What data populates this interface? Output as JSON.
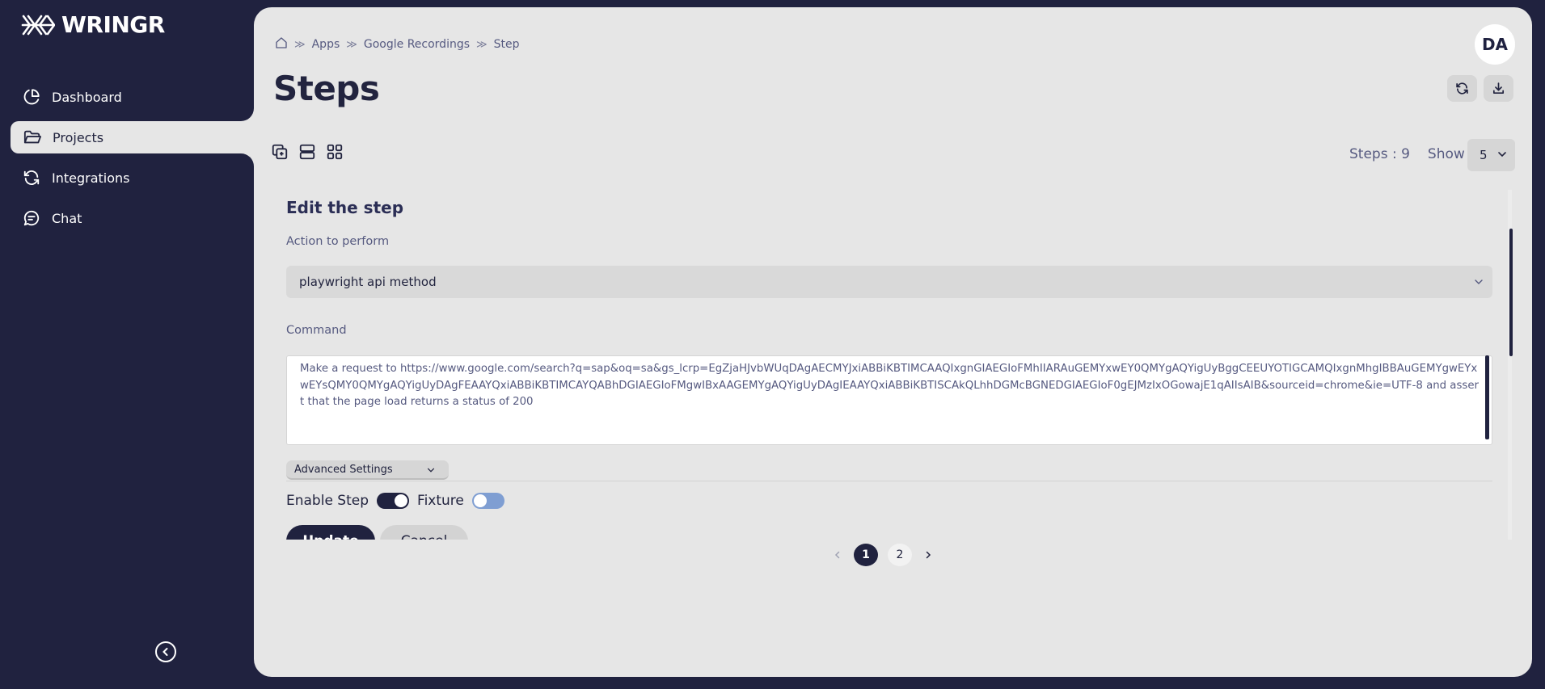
{
  "app": {
    "brand": "WRINGR"
  },
  "sidebar": {
    "items": [
      {
        "label": "Dashboard",
        "icon": "pie-chart-icon"
      },
      {
        "label": "Projects",
        "icon": "folder-icon",
        "active": true
      },
      {
        "label": "Integrations",
        "icon": "refresh-icon"
      },
      {
        "label": "Chat",
        "icon": "chat-icon"
      }
    ]
  },
  "breadcrumb": {
    "items": [
      "Apps",
      "Google Recordings",
      "Step"
    ]
  },
  "user": {
    "initials": "DA"
  },
  "page": {
    "title": "Steps"
  },
  "toolbar": {
    "steps_count": "Steps : 9",
    "show_label": "Show",
    "show_value": "5"
  },
  "form": {
    "title": "Edit the step",
    "action_label": "Action to perform",
    "action_value": "playwright api method",
    "command_label": "Command",
    "command_value": "Make a request to https://www.google.com/search?q=sap&oq=sa&gs_lcrp=EgZjaHJvbWUqDAgAECMYJxiABBiKBTIMCAAQIxgnGIAEGIoFMhIIARAuGEMYxwEY0QMYgAQYigUyBggCEEUYOTIGCAMQIxgnMhgIBBAuGEMYgwEYxwEYsQMY0QMYgAQYigUyDAgFEAAYQxiABBiKBTIMCAYQABhDGIAEGIoFMgwIBxAAGEMYgAQYigUyDAgIEAAYQxiABBiKBTISCAkQLhhDGMcBGNEDGIAEGIoF0gEJMzIxOGowajE1qAIIsAIB&sourceid=chrome&ie=UTF-8 and assert that the page load returns a status of 200",
    "advanced_settings_label": "Advanced Settings",
    "enable_step_label": "Enable Step",
    "enable_step_on": true,
    "fixture_label": "Fixture",
    "fixture_on": false,
    "update_label": "Update",
    "cancel_label": "Cancel"
  },
  "pagination": {
    "pages": [
      "1",
      "2"
    ],
    "current": "1"
  },
  "colors": {
    "sidebar_bg": "#20223f",
    "panel_bg": "#e6e6e6",
    "accent": "#20223f",
    "fixture_toggle": "#7f9ed2"
  }
}
